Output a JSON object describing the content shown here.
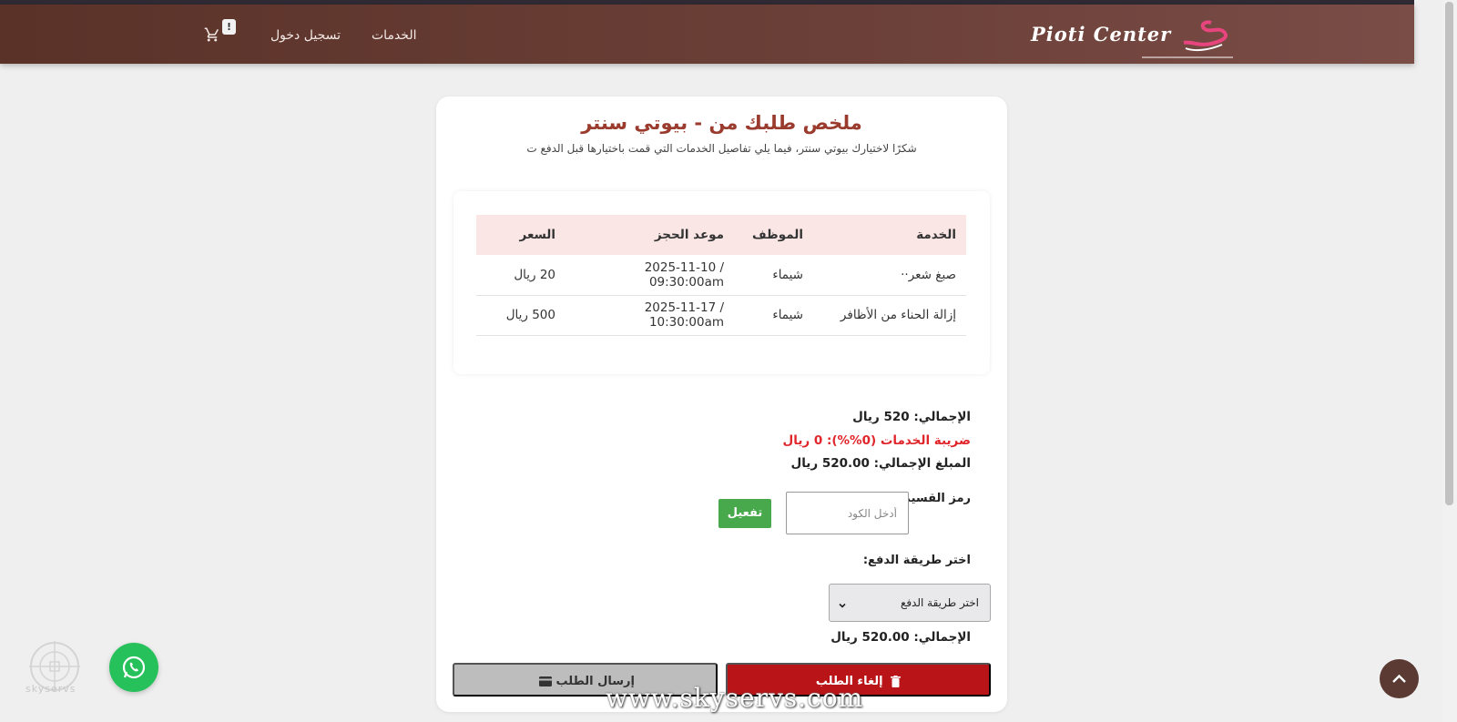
{
  "nav": {
    "logo_text": "Pioti Center",
    "cart_badge": "!",
    "login": "تسجيل دخول",
    "services": "الخدمات"
  },
  "summary": {
    "title": "ملخص طلبك من - بيوتي سنتر",
    "subtitle": "شكرًا لاختيارك بيوتي سنتر، فيما يلي تفاصيل الخدمات التي قمت باختيارها قبل الدفع ت",
    "table": {
      "headers": {
        "service": "الخدمة",
        "employee": "الموظف",
        "date": "موعد الحجز",
        "price": "السعر"
      },
      "rows": [
        {
          "service": "صبغ شعر··",
          "employee": "شيماء",
          "date": "2025-11-10 / 09:30:00am",
          "price": "20 ريال"
        },
        {
          "service": "إزالة الحناء من الأظافر",
          "employee": "شيماء",
          "date": "2025-11-17 / 10:30:00am",
          "price": "500 ريال"
        }
      ]
    },
    "total": "الإجمالي: 520 ريال",
    "tax": "ضريبة الخدمات (0%%): 0 ريال",
    "grand_total": "المبلغ الإجمالي: 520.00 ريال"
  },
  "coupon": {
    "label": "رمز القسيمة:",
    "placeholder": "أدخل الكود",
    "activate": "تفعيل"
  },
  "payment": {
    "label": "اختر طريقة الدفع:",
    "selected": "اختر طريقة الدفع"
  },
  "final_total": "الإجمالي: 520.00 ريال",
  "actions": {
    "cancel": "إلغاء الطلب",
    "submit": "إرسال الطلب"
  },
  "watermark": {
    "url": "www.skyservs.com",
    "brand": "skyservs"
  },
  "colors": {
    "navbar": "#6b4038",
    "title": "#9a3b2e",
    "tax": "#e0252b",
    "activate": "#47a94b",
    "cancel": "#b91518",
    "whatsapp": "#27c15b"
  },
  "icons": [
    "cart-icon",
    "chevron-down-icon",
    "trash-icon",
    "card-icon",
    "whatsapp-icon",
    "chevron-up-icon"
  ]
}
